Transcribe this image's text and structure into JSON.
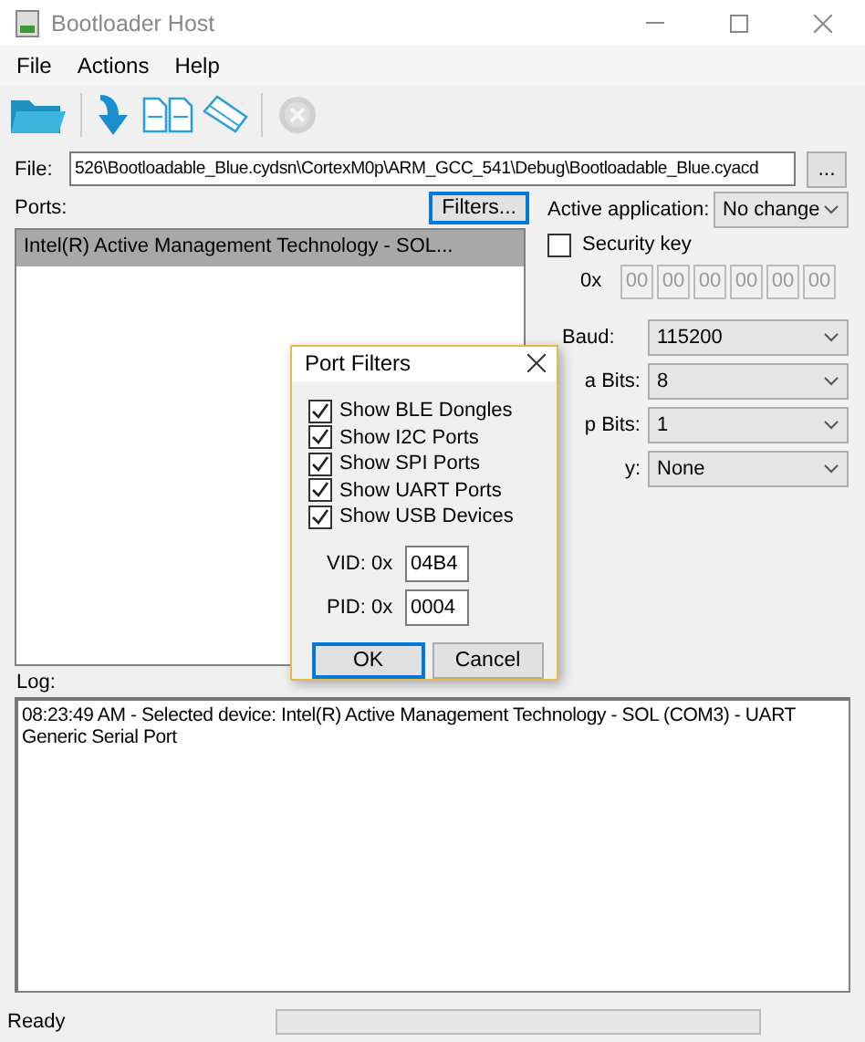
{
  "window": {
    "title": "Bootloader Host"
  },
  "menu": [
    "File",
    "Actions",
    "Help"
  ],
  "toolbar": [
    {
      "kind": "open",
      "disabled": false
    },
    {
      "kind": "program",
      "disabled": false
    },
    {
      "kind": "verify",
      "disabled": false
    },
    {
      "kind": "erase",
      "disabled": false
    },
    {
      "kind": "stop",
      "disabled": true
    }
  ],
  "file": {
    "label": "File:",
    "value": "526\\Bootloadable_Blue.cydsn\\CortexM0p\\ARM_GCC_541\\Debug\\Bootloadable_Blue.cyacd",
    "browse": "..."
  },
  "ports": {
    "label": "Ports:",
    "filters_button": "Filters...",
    "items": [
      {
        "text": "Intel(R) Active Management Technology - SOL...",
        "selected": true
      }
    ]
  },
  "settings": {
    "active_application": {
      "label": "Active application:",
      "value": "No change"
    },
    "security_key": {
      "label": "Security key",
      "checked": false,
      "prefix": "0x",
      "bytes": [
        "00",
        "00",
        "00",
        "00",
        "00",
        "00"
      ]
    },
    "serial": [
      {
        "label": "Baud:",
        "value": "115200"
      },
      {
        "label": "a Bits:",
        "value": "8"
      },
      {
        "label": "p Bits:",
        "value": "1"
      },
      {
        "label": "y:",
        "value": "None"
      }
    ]
  },
  "log": {
    "label": "Log:",
    "lines": [
      "08:23:49 AM - Selected device: Intel(R) Active Management Technology - SOL (COM3) - UART",
      "Generic Serial Port"
    ]
  },
  "status_bar": {
    "text": "Ready",
    "progress": {
      "level": 0
    }
  },
  "dialog": {
    "title": "Port Filters",
    "options": [
      {
        "label": "Show BLE Dongles",
        "checked": true
      },
      {
        "label": "Show I2C Ports",
        "checked": true
      },
      {
        "label": "Show SPI Ports",
        "checked": true
      },
      {
        "label": "Show UART Ports",
        "checked": true
      },
      {
        "label": "Show USB Devices",
        "checked": true
      }
    ],
    "fields": [
      {
        "label": "VID: 0x",
        "value": "04B4"
      },
      {
        "label": "PID: 0x",
        "value": "0004"
      }
    ],
    "buttons": [
      {
        "label": "OK",
        "default": true
      },
      {
        "label": "Cancel",
        "default": false
      }
    ]
  }
}
